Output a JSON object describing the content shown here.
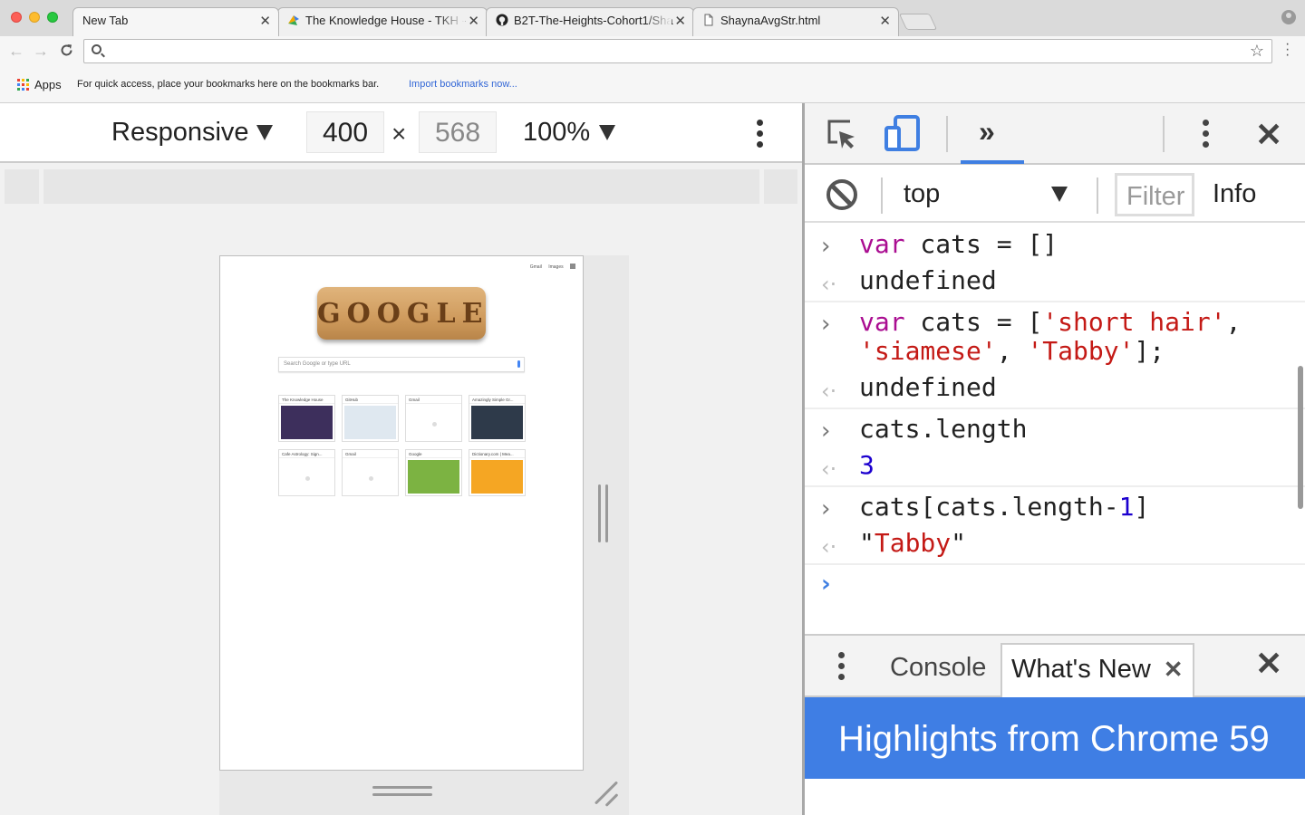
{
  "browser": {
    "tabs": [
      {
        "title": "New Tab",
        "icon": "none",
        "active": true
      },
      {
        "title": "The Knowledge House - TKH -",
        "icon": "tkh-favicon-icon"
      },
      {
        "title": "B2T-The-Heights-Cohort1/Sha",
        "icon": "github-icon"
      },
      {
        "title": "ShaynaAvgStr.html",
        "icon": "document-icon"
      }
    ],
    "tab_close_glyph": "✕",
    "omnibox_value": "",
    "bookmarks": {
      "apps_label": "Apps",
      "hint": "For quick access, place your bookmarks here on the bookmarks bar.",
      "import_link": "Import bookmarks now..."
    }
  },
  "device_toolbar": {
    "mode": "Responsive",
    "width": "400",
    "times": "×",
    "height": "568",
    "zoom": "100%"
  },
  "emulated_page": {
    "top_links": [
      "Gmail",
      "Images"
    ],
    "doodle_text": "GOOGLE",
    "search_placeholder": "Search Google or type URL",
    "tiles": [
      {
        "title": "The Knowledge House",
        "thumb_color": "#3d2f5c"
      },
      {
        "title": "GitHub",
        "thumb_color": "#dfe8f0"
      },
      {
        "title": "Gmail",
        "thumb_color": "#ffffff"
      },
      {
        "title": "Amazingly Simple Gr...",
        "thumb_color": "#2e3a4a"
      },
      {
        "title": "Cafe Astrology: Sign...",
        "thumb_color": "#ffffff"
      },
      {
        "title": "Gmail",
        "thumb_color": "#ffffff"
      },
      {
        "title": "Google",
        "thumb_color": "#7cb342"
      },
      {
        "title": "Dictionary.com | Mea...",
        "thumb_color": "#f5a623"
      }
    ]
  },
  "devtools": {
    "more_tabs_glyph": "»",
    "close_glyph": "✕",
    "context": "top",
    "filter_placeholder": "Filter",
    "level": "Info",
    "input_prompt": "›",
    "output_prompt": "‹·",
    "console": [
      {
        "kind": "in",
        "tokens": [
          {
            "t": "kw",
            "v": "var"
          },
          {
            "t": "plain",
            "v": " cats = []"
          }
        ]
      },
      {
        "kind": "out",
        "tokens": [
          {
            "t": "plain",
            "v": "undefined"
          }
        ]
      },
      {
        "kind": "in",
        "tokens": [
          {
            "t": "kw",
            "v": "var"
          },
          {
            "t": "plain",
            "v": " cats = ["
          },
          {
            "t": "str",
            "v": "'short hair'"
          },
          {
            "t": "plain",
            "v": ", "
          },
          {
            "t": "str",
            "v": "'siamese'"
          },
          {
            "t": "plain",
            "v": ", "
          },
          {
            "t": "str",
            "v": "'Tabby'"
          },
          {
            "t": "plain",
            "v": "];"
          }
        ]
      },
      {
        "kind": "out",
        "tokens": [
          {
            "t": "plain",
            "v": "undefined"
          }
        ]
      },
      {
        "kind": "in",
        "tokens": [
          {
            "t": "plain",
            "v": "cats.length"
          }
        ]
      },
      {
        "kind": "out",
        "tokens": [
          {
            "t": "num",
            "v": "3"
          }
        ]
      },
      {
        "kind": "in",
        "tokens": [
          {
            "t": "plain",
            "v": "cats[cats.length-"
          },
          {
            "t": "num",
            "v": "1"
          },
          {
            "t": "plain",
            "v": "]"
          }
        ]
      },
      {
        "kind": "out",
        "tokens": [
          {
            "t": "plain",
            "v": "\""
          },
          {
            "t": "str",
            "v": "Tabby"
          },
          {
            "t": "plain",
            "v": "\""
          }
        ]
      }
    ],
    "drawer": {
      "tabs": [
        {
          "label": "Console",
          "active": false
        },
        {
          "label": "What's New",
          "active": true,
          "close_glyph": "✕"
        }
      ],
      "close_glyph": "✕",
      "banner": "Highlights from Chrome 59"
    }
  },
  "colors": {
    "accent": "#3f7fe2",
    "banner": "#3f7ee4",
    "keyword": "#aa0d91",
    "string": "#c41a16",
    "number": "#1c00cf"
  }
}
